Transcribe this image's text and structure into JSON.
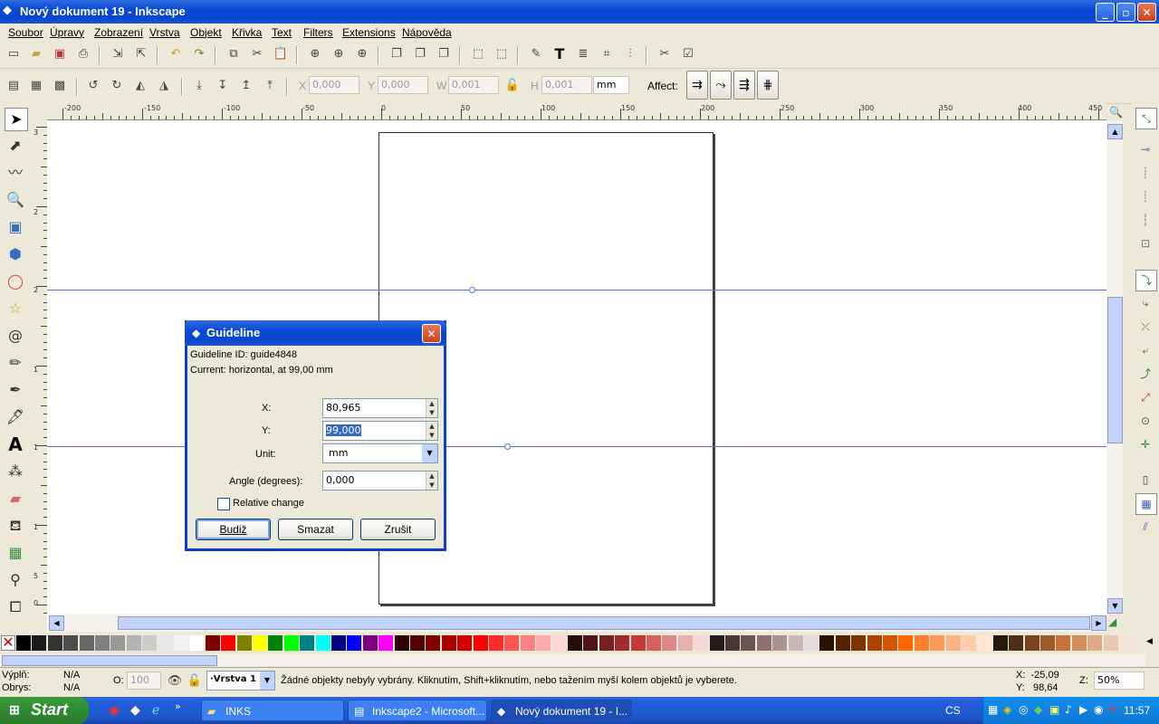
{
  "window": {
    "title": "Nový dokument 19 - Inkscape",
    "minimize": "_",
    "maximize": "▫",
    "close": "✕"
  },
  "menu": [
    "Soubor",
    "Úpravy",
    "Zobrazení",
    "Vrstva",
    "Objekt",
    "Křivka",
    "Text",
    "Filters",
    "Extensions",
    "Nápověda"
  ],
  "toolbar2": {
    "x_label": "X",
    "x_value": "0,000",
    "y_label": "Y",
    "y_value": "0,000",
    "w_label": "W",
    "w_value": "0,001",
    "h_label": "H",
    "h_value": "0,001",
    "unit": "mm",
    "affect_label": "Affect:"
  },
  "ruler": {
    "h_labels": [
      "-200",
      "-150",
      "-100",
      "-50",
      "0",
      "50",
      "100",
      "150",
      "200",
      "250",
      "300",
      "350",
      "400",
      "450"
    ],
    "v_labels": [
      "3",
      "2",
      "2",
      "1",
      "1",
      "1",
      "5",
      "0"
    ]
  },
  "dialog": {
    "title": "Guideline",
    "guide_id": "Guideline ID: guide4848",
    "current": "Current: horizontal, at 99,00 mm",
    "x_label": "X:",
    "x_value": "80,965",
    "y_label": "Y:",
    "y_value": "99,000",
    "unit_label": "Unit:",
    "unit_value": "mm",
    "angle_label": "Angle (degrees):",
    "angle_value": "0,000",
    "relative_label": "Relative change",
    "ok": "Budiž",
    "delete": "Smazat",
    "cancel": "Zrušit"
  },
  "palette_colors": [
    "#000000",
    "#1a1a1a",
    "#333333",
    "#4d4d4d",
    "#666666",
    "#808080",
    "#999999",
    "#b3b3b3",
    "#cccccc",
    "#e6e6e6",
    "#f2f2f2",
    "#ffffff",
    "#800000",
    "#ff0000",
    "#808000",
    "#ffff00",
    "#008000",
    "#00ff00",
    "#008080",
    "#00ffff",
    "#000080",
    "#0000ff",
    "#800080",
    "#ff00ff",
    "#2b0000",
    "#550000",
    "#800000",
    "#aa0000",
    "#d40000",
    "#ff0000",
    "#ff2a2a",
    "#ff5555",
    "#ff8080",
    "#ffaaaa",
    "#ffd5d5",
    "#280b0b",
    "#501616",
    "#782121",
    "#a02c2c",
    "#c83737",
    "#d35f5f",
    "#de8787",
    "#e9afaf",
    "#f4d7d7",
    "#241c1c",
    "#483737",
    "#6c5353",
    "#916f6f",
    "#ac9393",
    "#c8b7b7",
    "#e3dbdb",
    "#2b1100",
    "#552200",
    "#803300",
    "#aa4400",
    "#d45500",
    "#ff6600",
    "#ff7f2a",
    "#ff9955",
    "#ffb380",
    "#ffccaa",
    "#ffe6d5",
    "#28170b",
    "#502d16",
    "#784421",
    "#a05a2c",
    "#c87137",
    "#d38d5f",
    "#deaa87",
    "#e9c6af",
    "#f4e3d7"
  ],
  "status": {
    "fill_label": "Výplň:",
    "fill_value": "N/A",
    "stroke_label": "Obrys:",
    "stroke_value": "N/A",
    "opacity_label": "O:",
    "opacity_value": "100",
    "layer": "·Vrstva 1",
    "message": "Žádné objekty nebyly vybrány. Kliknutím, Shift+kliknutím, nebo tažením myší kolem objektů je vyberete.",
    "x_coord": "X:  -25,09",
    "y_coord": "Y:   98,64",
    "zoom_label": "Z:",
    "zoom_value": "50%"
  },
  "taskbar": {
    "start": "Start",
    "tasks": [
      "INKS",
      "Inkscape2 - Microsoft...",
      "Nový dokument 19 - I..."
    ],
    "lang": "CS",
    "clock": "11:57"
  }
}
